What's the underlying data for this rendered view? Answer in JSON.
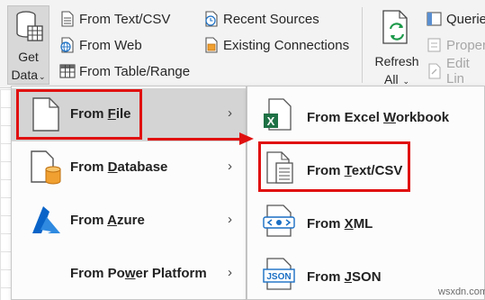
{
  "ribbon": {
    "get_data": {
      "line1": "Get",
      "line2": "Data",
      "chevron": "⌄"
    },
    "from_text_csv": "From Text/CSV",
    "from_web": "From Web",
    "from_table_range": "From Table/Range",
    "recent_sources": "Recent Sources",
    "existing_connections": "Existing Connections",
    "refresh": {
      "line1": "Refresh",
      "line2": "All",
      "chevron": "⌄"
    },
    "queries": "Querie",
    "properties": "Proper",
    "edit_links": "Edit Lin"
  },
  "menu": {
    "items": [
      {
        "pre": "From ",
        "u": "F",
        "post": "ile",
        "arrow": "›",
        "selected": true
      },
      {
        "pre": "From ",
        "u": "D",
        "post": "atabase",
        "arrow": "›"
      },
      {
        "pre": "From ",
        "u": "A",
        "post": "zure",
        "arrow": "›"
      },
      {
        "pre": "From Po",
        "u": "w",
        "post": "er Platform",
        "arrow": "›"
      }
    ]
  },
  "submenu": {
    "items": [
      {
        "pre": "From Excel ",
        "u": "W",
        "post": "orkbook"
      },
      {
        "pre": "From ",
        "u": "T",
        "post": "ext/CSV"
      },
      {
        "pre": "From ",
        "u": "X",
        "post": "ML"
      },
      {
        "pre": "From ",
        "u": "J",
        "post": "SON"
      }
    ]
  },
  "icons": {
    "excel_x": "X",
    "json_label": "JSON"
  },
  "colors": {
    "highlight_red": "#e01010",
    "excel_green": "#1e7145",
    "azure_blue": "#0a64c8",
    "xml_blue": "#1a6fc4",
    "database_orange": "#f0a030"
  },
  "watermark": "wsxdn.com"
}
